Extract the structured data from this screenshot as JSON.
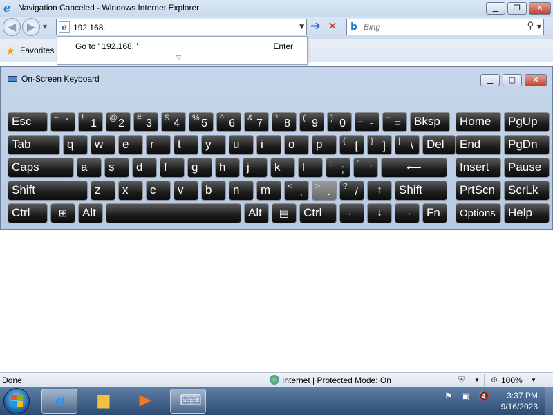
{
  "window": {
    "title": "Navigation Canceled - Windows Internet Explorer",
    "minimize": "▁",
    "restore": "❐",
    "close": "✕"
  },
  "nav": {
    "back": "◀",
    "forward": "▶",
    "address_value": "192.168.",
    "go": "➔",
    "stop": "✕",
    "search_placeholder": "Bing"
  },
  "favorites": {
    "label": "Favorites"
  },
  "autocomplete": {
    "goto_text": "Go to ' 192.168. '",
    "enter_label": "Enter"
  },
  "osk": {
    "title": "On-Screen Keyboard",
    "minimize": "▁",
    "restore": "▢",
    "close": "✕",
    "rows": [
      [
        {
          "id": "esc",
          "main": "Esc"
        },
        {
          "id": "tilde",
          "sup": "~",
          "main": "`"
        },
        {
          "id": "1",
          "sup": "!",
          "main": "1"
        },
        {
          "id": "2",
          "sup": "@",
          "main": "2"
        },
        {
          "id": "3",
          "sup": "#",
          "main": "3"
        },
        {
          "id": "4",
          "sup": "$",
          "main": "4"
        },
        {
          "id": "5",
          "sup": "%",
          "main": "5"
        },
        {
          "id": "6",
          "sup": "^",
          "main": "6"
        },
        {
          "id": "7",
          "sup": "&",
          "main": "7"
        },
        {
          "id": "8",
          "sup": "*",
          "main": "8"
        },
        {
          "id": "9",
          "sup": "(",
          "main": "9"
        },
        {
          "id": "0",
          "sup": ")",
          "main": "0"
        },
        {
          "id": "minus",
          "sup": "_",
          "main": "-"
        },
        {
          "id": "equals",
          "sup": "+",
          "main": "="
        },
        {
          "id": "bksp",
          "main": "Bksp"
        },
        {
          "id": "home",
          "main": "Home"
        },
        {
          "id": "pgup",
          "main": "PgUp"
        }
      ],
      [
        {
          "id": "tab",
          "main": "Tab"
        },
        {
          "id": "q",
          "main": "q"
        },
        {
          "id": "w",
          "main": "w"
        },
        {
          "id": "e",
          "main": "e"
        },
        {
          "id": "r",
          "main": "r"
        },
        {
          "id": "t",
          "main": "t"
        },
        {
          "id": "y",
          "main": "y"
        },
        {
          "id": "u",
          "main": "u"
        },
        {
          "id": "i",
          "main": "i"
        },
        {
          "id": "o",
          "main": "o"
        },
        {
          "id": "p",
          "main": "p"
        },
        {
          "id": "lbracket",
          "sup": "{",
          "main": "["
        },
        {
          "id": "rbracket",
          "sup": "}",
          "main": "]"
        },
        {
          "id": "backslash",
          "sup": "|",
          "main": "\\"
        },
        {
          "id": "del",
          "main": "Del"
        },
        {
          "id": "end",
          "main": "End"
        },
        {
          "id": "pgdn",
          "main": "PgDn"
        }
      ],
      [
        {
          "id": "caps",
          "main": "Caps"
        },
        {
          "id": "a",
          "main": "a"
        },
        {
          "id": "s",
          "main": "s"
        },
        {
          "id": "d",
          "main": "d"
        },
        {
          "id": "f",
          "main": "f"
        },
        {
          "id": "g",
          "main": "g"
        },
        {
          "id": "h",
          "main": "h"
        },
        {
          "id": "j",
          "main": "j"
        },
        {
          "id": "k",
          "main": "k"
        },
        {
          "id": "l",
          "main": "l"
        },
        {
          "id": "semicolon",
          "sup": ":",
          "main": ";"
        },
        {
          "id": "quote",
          "sup": "\"",
          "main": "'"
        },
        {
          "id": "enter",
          "sym": "⟵"
        },
        {
          "id": "insert",
          "main": "Insert"
        },
        {
          "id": "pause",
          "main": "Pause"
        }
      ],
      [
        {
          "id": "lshift",
          "main": "Shift"
        },
        {
          "id": "z",
          "main": "z"
        },
        {
          "id": "x",
          "main": "x"
        },
        {
          "id": "c",
          "main": "c"
        },
        {
          "id": "v",
          "main": "v"
        },
        {
          "id": "b",
          "main": "b"
        },
        {
          "id": "n",
          "main": "n"
        },
        {
          "id": "m",
          "main": "m"
        },
        {
          "id": "comma",
          "sup": "<",
          "main": ","
        },
        {
          "id": "period",
          "sup": ">",
          "main": "."
        },
        {
          "id": "slash",
          "sup": "?",
          "main": "/"
        },
        {
          "id": "up",
          "sym": "↑"
        },
        {
          "id": "rshift",
          "main": "Shift"
        },
        {
          "id": "prtscn",
          "main": "PrtScn"
        },
        {
          "id": "scrlk",
          "main": "ScrLk"
        }
      ],
      [
        {
          "id": "lctrl",
          "main": "Ctrl"
        },
        {
          "id": "win",
          "sym": "⊞"
        },
        {
          "id": "lalt",
          "main": "Alt"
        },
        {
          "id": "space",
          "main": ""
        },
        {
          "id": "ralt",
          "main": "Alt"
        },
        {
          "id": "menu",
          "sym": "▤"
        },
        {
          "id": "rctrl",
          "main": "Ctrl"
        },
        {
          "id": "left",
          "sym": "←"
        },
        {
          "id": "down",
          "sym": "↓"
        },
        {
          "id": "right",
          "sym": "→"
        },
        {
          "id": "fn",
          "main": "Fn"
        },
        {
          "id": "options",
          "main": "Options"
        },
        {
          "id": "help",
          "main": "Help"
        }
      ]
    ],
    "hovered_key": "period"
  },
  "status": {
    "left": "Done",
    "zone": "Internet | Protected Mode: On",
    "zoom": "100%"
  },
  "taskbar": {
    "apps": [
      "internet-explorer",
      "windows-explorer",
      "media-player",
      "on-screen-keyboard"
    ],
    "active_app": "internet-explorer",
    "time": "3:37 PM",
    "date": "9/16/2023"
  }
}
